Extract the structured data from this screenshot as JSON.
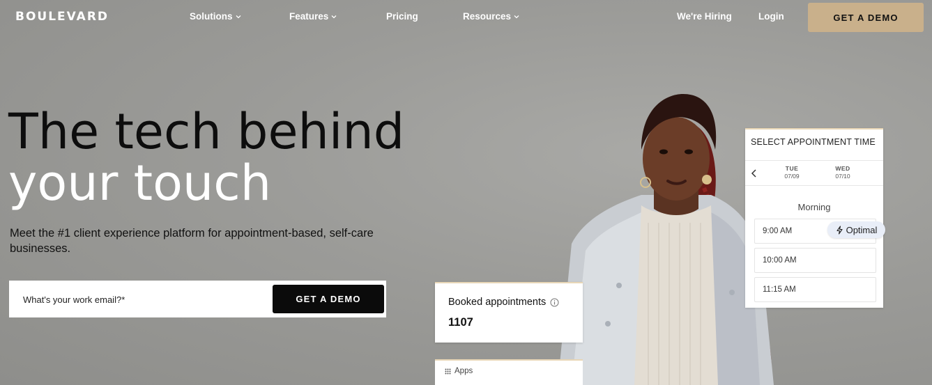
{
  "brand": "BOULEVARD",
  "nav": {
    "items": [
      {
        "label": "Solutions",
        "has_dropdown": true
      },
      {
        "label": "Features",
        "has_dropdown": true
      },
      {
        "label": "Pricing",
        "has_dropdown": false
      },
      {
        "label": "Resources",
        "has_dropdown": true
      }
    ],
    "hiring": "We're Hiring",
    "login": "Login",
    "cta": "GET A DEMO"
  },
  "hero": {
    "headline_line1": "The tech behind",
    "headline_line2": "your touch",
    "subtext": "Meet the #1 client experience platform for appointment-based, self-care businesses.",
    "email_placeholder": "What's your work email?*",
    "cta": "GET A DEMO"
  },
  "appointment_card": {
    "title": "SELECT APPOINTMENT TIME",
    "days": [
      {
        "dow": "TUE",
        "date": "07/09"
      },
      {
        "dow": "WED",
        "date": "07/10"
      }
    ],
    "period": "Morning",
    "slots": [
      "9:00 AM",
      "10:00 AM",
      "11:15 AM"
    ],
    "optimal_label": "Optimal"
  },
  "booked_card": {
    "label": "Booked appointments",
    "value": "1107"
  },
  "apps_card": {
    "label": "Apps"
  },
  "colors": {
    "accent": "#c9b08b",
    "background": "#9b9b98",
    "primary_button": "#0b0b0b"
  }
}
